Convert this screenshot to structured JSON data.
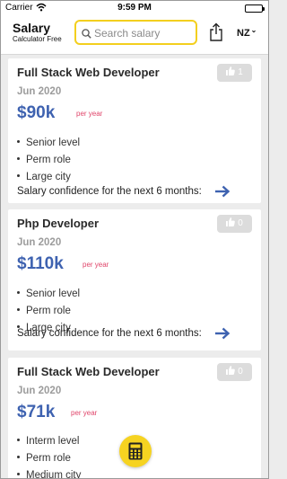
{
  "status_bar": {
    "carrier": "Carrier",
    "time": "9:59 PM"
  },
  "header": {
    "app_name": "Salary",
    "app_tagline": "Calculator Free",
    "search_placeholder": "Search salary",
    "country": "NZ"
  },
  "jobs": [
    {
      "title": "Full Stack Web Developer",
      "date": "Jun 2020",
      "salary": "$90k",
      "period": "per year",
      "likes": "1",
      "attributes": [
        "Senior level",
        "Perm role",
        "Large city"
      ],
      "confidence_label": "Salary confidence for the next 6 months:"
    },
    {
      "title": "Php Developer",
      "date": "Jun 2020",
      "salary": "$110k",
      "period": "per year",
      "likes": "0",
      "attributes": [
        "Senior level",
        "Perm role",
        "Large city"
      ],
      "confidence_label": "Salary confidence for the next 6 months:"
    },
    {
      "title": "Full Stack Web Developer",
      "date": "Jun 2020",
      "salary": "$71k",
      "period": "per year",
      "likes": "0",
      "attributes": [
        "Interm level",
        "Perm role",
        "Medium city"
      ],
      "confidence_label": ""
    }
  ],
  "colors": {
    "accent_yellow": "#f3cf1e",
    "salary_blue": "#3e62b0",
    "period_pink": "#e0456a",
    "date_grey": "#9c9c9c"
  },
  "icons": {
    "search": "search-icon",
    "share": "share-icon",
    "like": "thumbs-up-icon",
    "confidence": "arrow-right-icon",
    "fab": "calculator-icon"
  }
}
